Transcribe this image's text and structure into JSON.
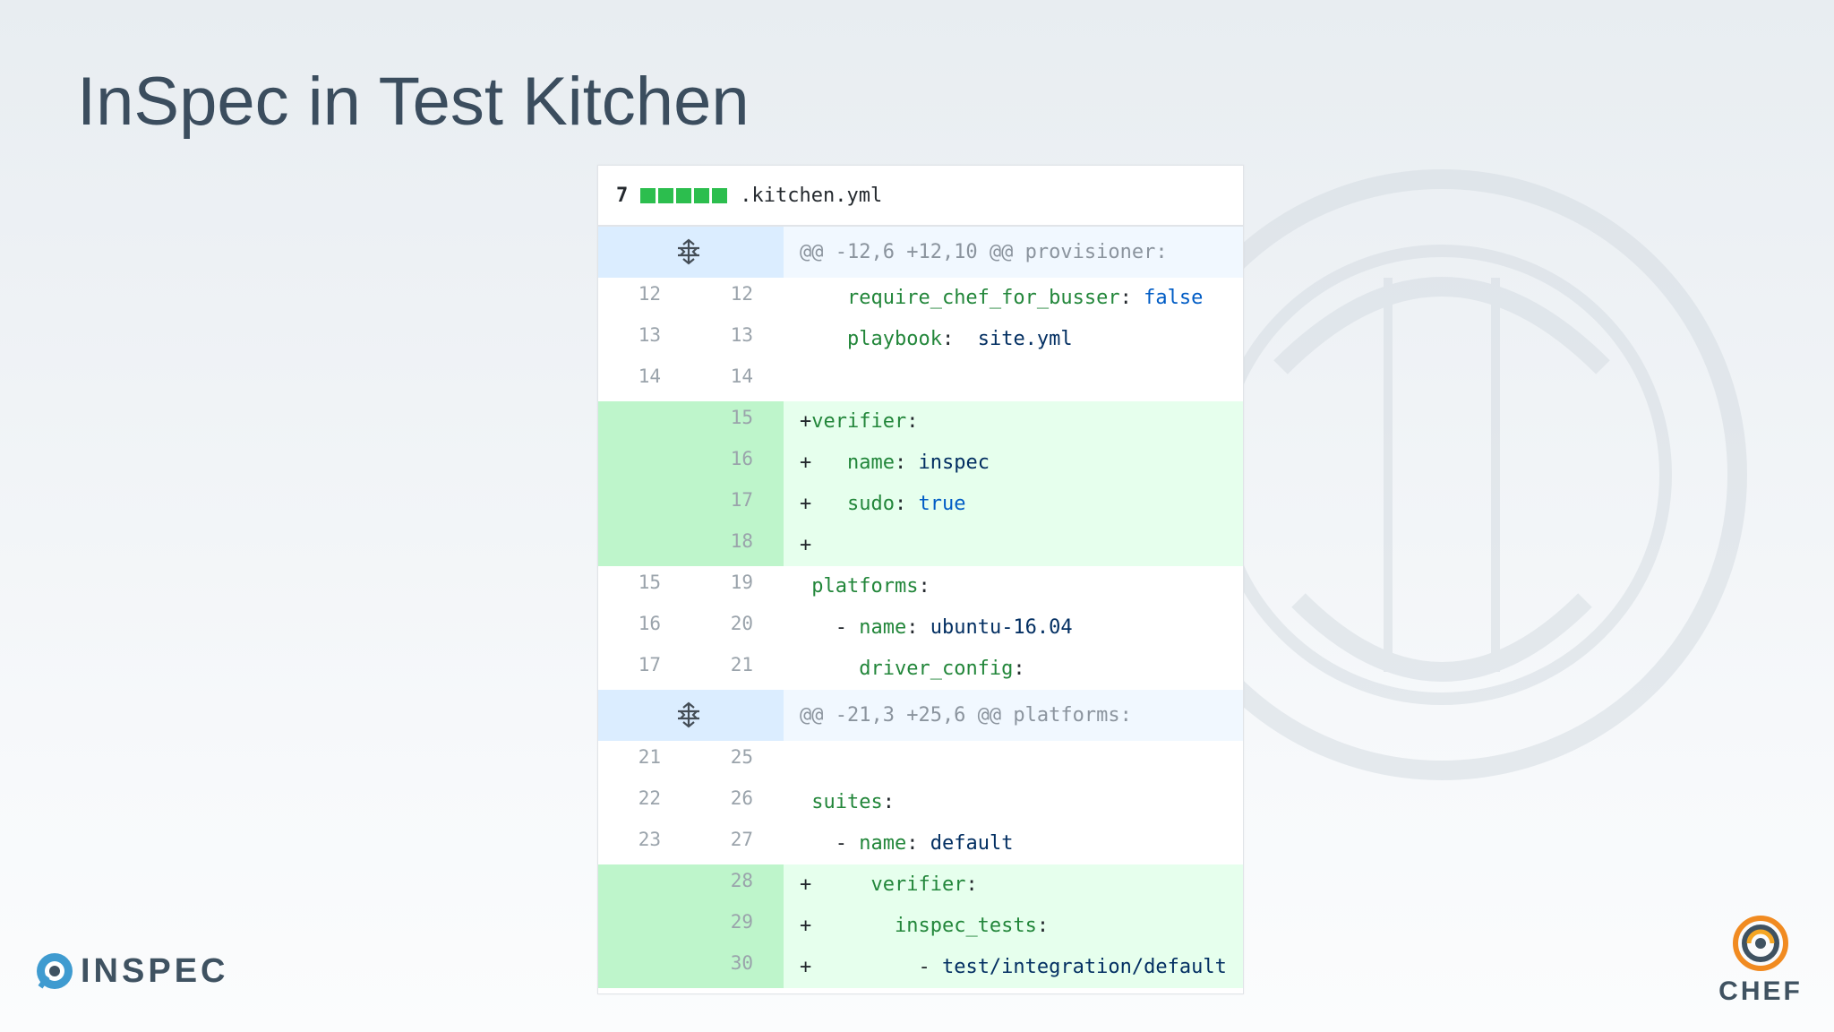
{
  "slide": {
    "title": "InSpec in Test Kitchen"
  },
  "diff": {
    "header": {
      "count": "7",
      "stat_blocks": 5,
      "filename": ".kitchen.yml"
    },
    "hunks": [
      {
        "header": "@@ -12,6 +12,10 @@ provisioner:",
        "lines": [
          {
            "old": "12",
            "new": "12",
            "type": "context",
            "indent": "    ",
            "parts": [
              {
                "t": "require_chef_for_busser",
                "c": "k"
              },
              {
                "t": ": ",
                "c": "p"
              },
              {
                "t": "false",
                "c": "b"
              }
            ]
          },
          {
            "old": "13",
            "new": "13",
            "type": "context",
            "indent": "    ",
            "parts": [
              {
                "t": "playbook",
                "c": "k"
              },
              {
                "t": ":  ",
                "c": "p"
              },
              {
                "t": "site.yml",
                "c": "v"
              }
            ]
          },
          {
            "old": "14",
            "new": "14",
            "type": "context",
            "indent": "",
            "parts": []
          },
          {
            "old": "",
            "new": "15",
            "type": "add",
            "indent": "+",
            "parts": [
              {
                "t": "verifier",
                "c": "k"
              },
              {
                "t": ":",
                "c": "p"
              }
            ]
          },
          {
            "old": "",
            "new": "16",
            "type": "add",
            "indent": "+   ",
            "parts": [
              {
                "t": "name",
                "c": "k"
              },
              {
                "t": ": ",
                "c": "p"
              },
              {
                "t": "inspec",
                "c": "v"
              }
            ]
          },
          {
            "old": "",
            "new": "17",
            "type": "add",
            "indent": "+   ",
            "parts": [
              {
                "t": "sudo",
                "c": "k"
              },
              {
                "t": ": ",
                "c": "p"
              },
              {
                "t": "true",
                "c": "b"
              }
            ]
          },
          {
            "old": "",
            "new": "18",
            "type": "add",
            "indent": "+",
            "parts": []
          },
          {
            "old": "15",
            "new": "19",
            "type": "context",
            "indent": " ",
            "parts": [
              {
                "t": "platforms",
                "c": "k"
              },
              {
                "t": ":",
                "c": "p"
              }
            ]
          },
          {
            "old": "16",
            "new": "20",
            "type": "context",
            "indent": "   - ",
            "parts": [
              {
                "t": "name",
                "c": "k"
              },
              {
                "t": ": ",
                "c": "p"
              },
              {
                "t": "ubuntu-16.04",
                "c": "v"
              }
            ]
          },
          {
            "old": "17",
            "new": "21",
            "type": "context",
            "indent": "     ",
            "parts": [
              {
                "t": "driver_config",
                "c": "k"
              },
              {
                "t": ":",
                "c": "p"
              }
            ]
          }
        ]
      },
      {
        "header": "@@ -21,3 +25,6 @@ platforms:",
        "lines": [
          {
            "old": "21",
            "new": "25",
            "type": "context",
            "indent": "",
            "parts": []
          },
          {
            "old": "22",
            "new": "26",
            "type": "context",
            "indent": " ",
            "parts": [
              {
                "t": "suites",
                "c": "k"
              },
              {
                "t": ":",
                "c": "p"
              }
            ]
          },
          {
            "old": "23",
            "new": "27",
            "type": "context",
            "indent": "   - ",
            "parts": [
              {
                "t": "name",
                "c": "k"
              },
              {
                "t": ": ",
                "c": "p"
              },
              {
                "t": "default",
                "c": "v"
              }
            ]
          },
          {
            "old": "",
            "new": "28",
            "type": "add",
            "indent": "+     ",
            "parts": [
              {
                "t": "verifier",
                "c": "k"
              },
              {
                "t": ":",
                "c": "p"
              }
            ]
          },
          {
            "old": "",
            "new": "29",
            "type": "add",
            "indent": "+       ",
            "parts": [
              {
                "t": "inspec_tests",
                "c": "k"
              },
              {
                "t": ":",
                "c": "p"
              }
            ]
          },
          {
            "old": "",
            "new": "30",
            "type": "add",
            "indent": "+         - ",
            "parts": [
              {
                "t": "test/integration/default",
                "c": "v"
              }
            ]
          }
        ]
      }
    ]
  },
  "logos": {
    "inspec": "INSPEC",
    "chef": "CHEF"
  },
  "colors": {
    "title": "#3b4d5e",
    "addition_bg": "#e6ffed",
    "hunk_bg": "#f1f8ff",
    "stat_green": "#2cbe4e",
    "yaml_key": "#22863a",
    "yaml_value": "#032f62",
    "yaml_bool": "#005cc5"
  },
  "icons": [
    "unfold-icon",
    "inspec-logo-icon",
    "chef-logo-icon"
  ]
}
